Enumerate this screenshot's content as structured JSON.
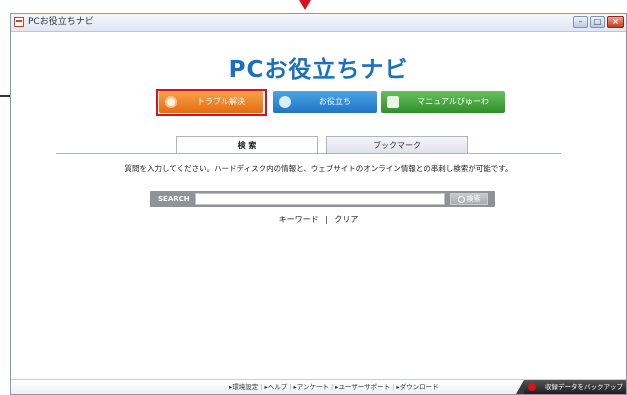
{
  "window": {
    "title": "PCお役立ちナビ",
    "controls": [
      "minimize-icon",
      "maximize-icon",
      "close-icon"
    ]
  },
  "app": {
    "logo_text": "PCお役立ちナビ"
  },
  "nav_buttons": [
    {
      "label": "トラブル解決",
      "icon": "trouble-lifebuoy-icon",
      "color": "#e46c11",
      "highlighted": true
    },
    {
      "label": "お役立ち",
      "icon": "useful-gear-icon",
      "color": "#1f74c4"
    },
    {
      "label": "マニュアルびゅーわ",
      "icon": "manual-book-icon",
      "color": "#2f8f2b"
    }
  ],
  "tabs": [
    {
      "label": "検 索",
      "active": true
    },
    {
      "label": "ブックマーク",
      "active": false
    }
  ],
  "instruction": "質問を入力してください。ハードディスク内の情報と、ウェブサイトのオンライン情報との串刺し検索が可能です。",
  "search": {
    "label": "SEARCH",
    "value": "",
    "placeholder": "",
    "button_label": "検索"
  },
  "links": {
    "keyword": "キーワード",
    "separator": "|",
    "clear": "クリア"
  },
  "footer": {
    "links": [
      "環境設定",
      "ヘルプ",
      "アンケート",
      "ユーザーサポート",
      "ダウンロード"
    ],
    "backup_button": "収録データをバックアップ"
  },
  "colors": {
    "accent_blue": "#1b6fbf",
    "highlight_red": "#d6121b"
  }
}
